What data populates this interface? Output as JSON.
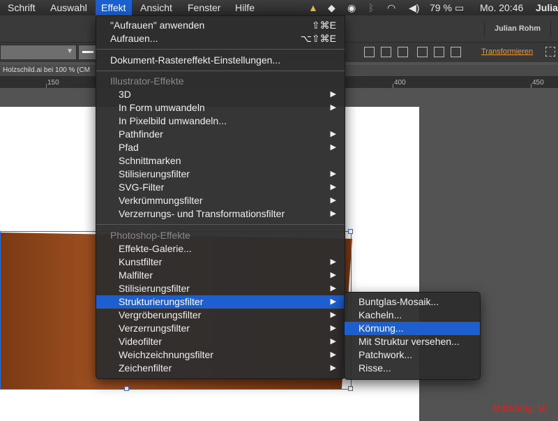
{
  "menubar": {
    "items": [
      "Schrift",
      "Auswahl",
      "Effekt",
      "Ansicht",
      "Fenster",
      "Hilfe"
    ],
    "battery": "79 %",
    "clock": "Mo. 20:46",
    "user_short": "Julia"
  },
  "appbar": {
    "user": "Julian Rohm"
  },
  "controlbar": {
    "transform_label": "Transformieren"
  },
  "document": {
    "tab_title": "Holzschild.ai bei 100 % (CM"
  },
  "ruler": {
    "labels": [
      "150",
      "400",
      "450"
    ]
  },
  "effekt_menu": {
    "apply_last": "\"Aufrauen\" anwenden",
    "apply_last_shortcut": "⇧⌘E",
    "last_effect": "Aufrauen...",
    "last_effect_shortcut": "⌥⇧⌘E",
    "raster_settings": "Dokument-Rastereffekt-Einstellungen...",
    "illustrator_header": "Illustrator-Effekte",
    "illustrator_items": [
      "3D",
      "In Form umwandeln",
      "In Pixelbild umwandeln...",
      "Pathfinder",
      "Pfad",
      "Schnittmarken",
      "Stilisierungsfilter",
      "SVG-Filter",
      "Verkrümmungsfilter",
      "Verzerrungs- und Transformationsfilter"
    ],
    "photoshop_header": "Photoshop-Effekte",
    "photoshop_items": [
      "Effekte-Galerie...",
      "Kunstfilter",
      "Malfilter",
      "Stilisierungsfilter",
      "Strukturierungsfilter",
      "Vergröberungsfilter",
      "Verzerrungsfilter",
      "Videofilter",
      "Weichzeichnungsfilter",
      "Zeichenfilter"
    ]
  },
  "struktur_submenu": {
    "items": [
      "Buntglas-Mosaik...",
      "Kacheln...",
      "Körnung...",
      "Mit Struktur versehen...",
      "Patchwork...",
      "Risse..."
    ],
    "highlighted": "Körnung..."
  },
  "figure_label": "Abbildung: 10",
  "colors": {
    "menu_highlight": "#1d5fd1",
    "wood": "#9a4a1e",
    "figure_label": "#e02020"
  }
}
